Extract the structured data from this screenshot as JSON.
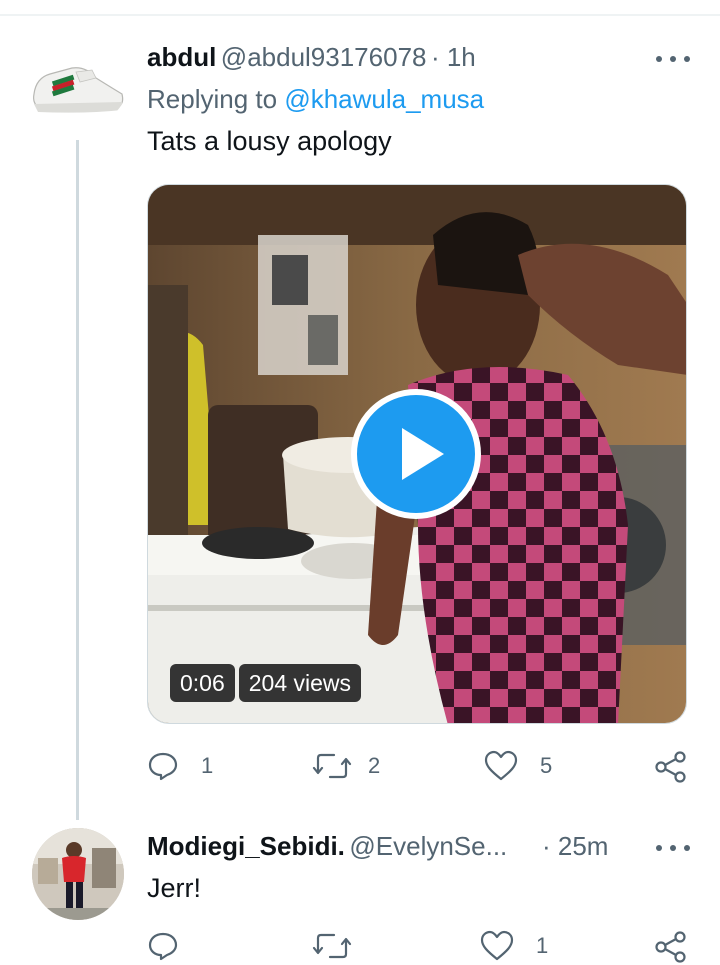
{
  "tweet1": {
    "display_name": "abdul",
    "handle": "@abdul93176078",
    "time": "· 1h",
    "replying_prefix": "Replying to",
    "replying_to": "@khawula_musa",
    "text": "Tats a lousy apology",
    "video": {
      "duration": "0:06",
      "views": "204 views"
    },
    "actions": {
      "replies": "1",
      "retweets": "2",
      "likes": "5"
    },
    "avatar_icon": "sneaker-avatar"
  },
  "tweet2": {
    "display_name": "Modiegi_Sebidi.",
    "handle": "@EvelynSe...",
    "time": "· 25m",
    "text": "Jerr!",
    "actions": {
      "replies": "",
      "retweets": "",
      "likes": "1"
    }
  },
  "colors": {
    "accent": "#1d9bf0",
    "secondary_text": "#536471",
    "primary_text": "#0f1419",
    "divider": "#cfd9de"
  }
}
